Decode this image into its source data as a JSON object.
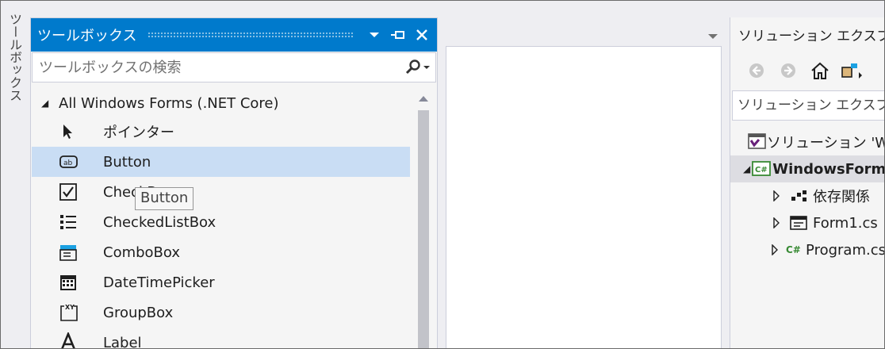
{
  "side_tab": {
    "label": "ツールボックス"
  },
  "toolbox": {
    "title": "ツールボックス",
    "search_placeholder": "ツールボックスの検索",
    "category": "All Windows Forms (.NET Core)",
    "items": [
      {
        "label": "ポインター",
        "icon": "pointer-icon"
      },
      {
        "label": "Button",
        "icon": "button-icon",
        "selected": true
      },
      {
        "label": "CheckBox",
        "icon": "checkbox-icon"
      },
      {
        "label": "CheckedListBox",
        "icon": "checkedlistbox-icon"
      },
      {
        "label": "ComboBox",
        "icon": "combobox-icon"
      },
      {
        "label": "DateTimePicker",
        "icon": "datetimepicker-icon"
      },
      {
        "label": "GroupBox",
        "icon": "groupbox-icon"
      },
      {
        "label": "Label",
        "icon": "label-icon"
      }
    ],
    "tooltip": "Button"
  },
  "solution_explorer": {
    "title": "ソリューション エクスプローラー",
    "search_placeholder": "ソリューション エクスプローラーの検索",
    "tree": [
      {
        "label": "ソリューション 'WindowsFormsApp'",
        "icon": "solution-icon"
      },
      {
        "label": "WindowsFormsApp",
        "icon": "csharp-project-icon",
        "bold": true
      },
      {
        "label": "依存関係",
        "icon": "dependencies-icon"
      },
      {
        "label": "Form1.cs",
        "icon": "form-icon"
      },
      {
        "label": "Program.cs",
        "icon": "csharp-file-icon"
      }
    ]
  },
  "colors": {
    "accent": "#007acc",
    "selection": "#c9ddf4",
    "panel": "#f5f5f5"
  }
}
